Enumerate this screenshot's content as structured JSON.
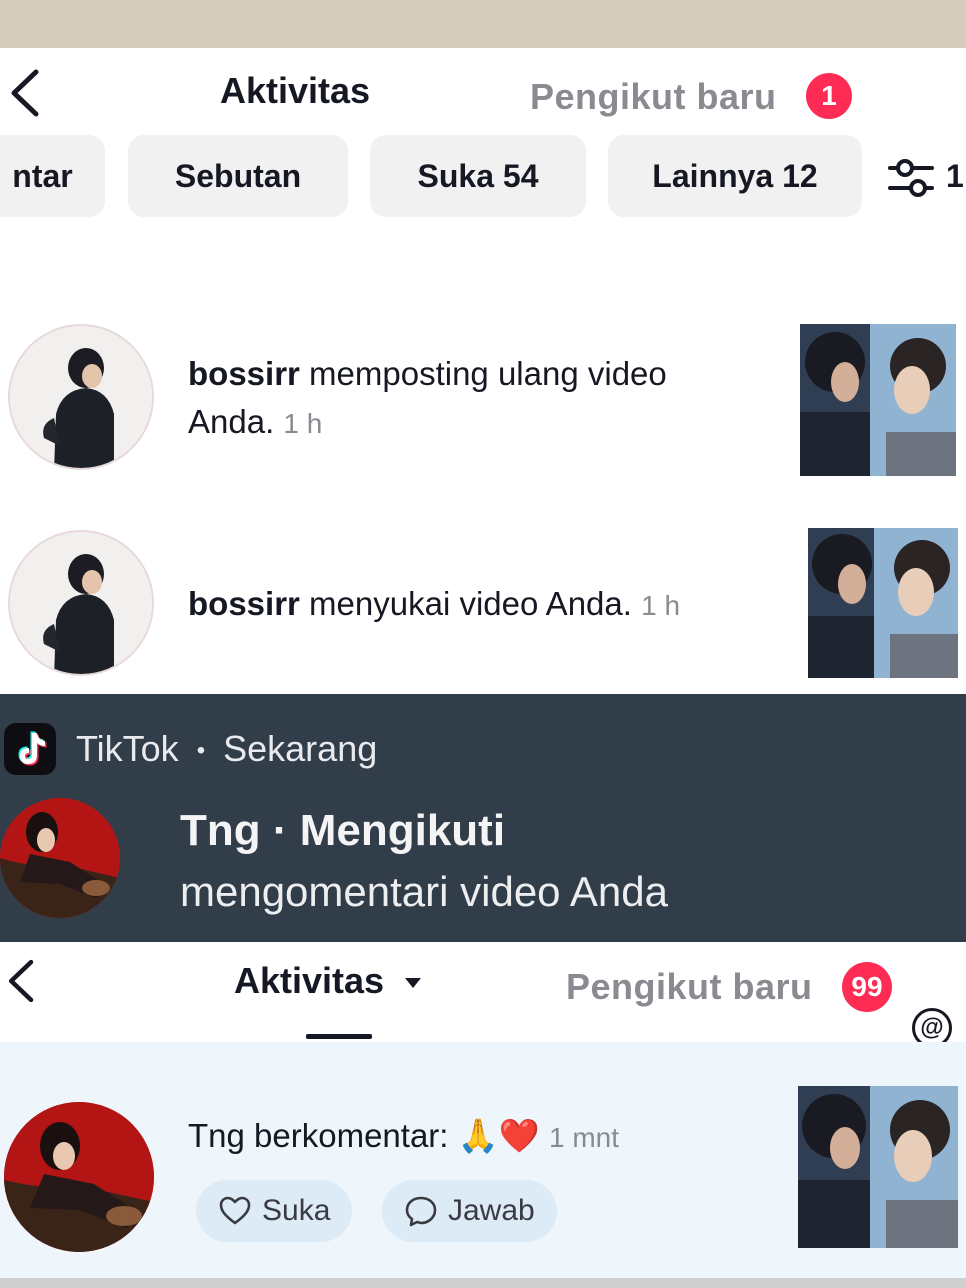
{
  "panel1": {
    "tab_active": "Aktivitas",
    "tab_followers": "Pengikut baru",
    "followers_badge": "1",
    "filters": [
      {
        "label": "ntar"
      },
      {
        "label": "Sebutan"
      },
      {
        "label": "Suka 54"
      },
      {
        "label": "Lainnya 12"
      }
    ],
    "filter_count": "1",
    "notifications": [
      {
        "user": "bossirr",
        "action_line1": " memposting ulang video",
        "action_line2": "Anda.",
        "time": "1 h"
      },
      {
        "user": "bossirr",
        "action": " menyukai video Anda.",
        "time": "1 h"
      }
    ]
  },
  "toast": {
    "app": "TikTok",
    "separator": "•",
    "when": "Sekarang",
    "title": "Tng · Mengikuti",
    "body": "mengomentari video Anda"
  },
  "panel2": {
    "tab_active": "Aktivitas",
    "tab_followers": "Pengikut baru",
    "followers_badge": "99",
    "comment": {
      "user": "Tng",
      "action": " berkomentar: ",
      "emoji": "🙏❤️",
      "time": "1 mnt"
    },
    "like_label": "Suka",
    "reply_label": "Jawab",
    "mention_glyph": "@"
  },
  "colors": {
    "accent": "#fe2c55",
    "toast_bg": "#323d4a",
    "chip_bg": "#f1f1f2",
    "highlight_bg": "#eef6fc"
  }
}
